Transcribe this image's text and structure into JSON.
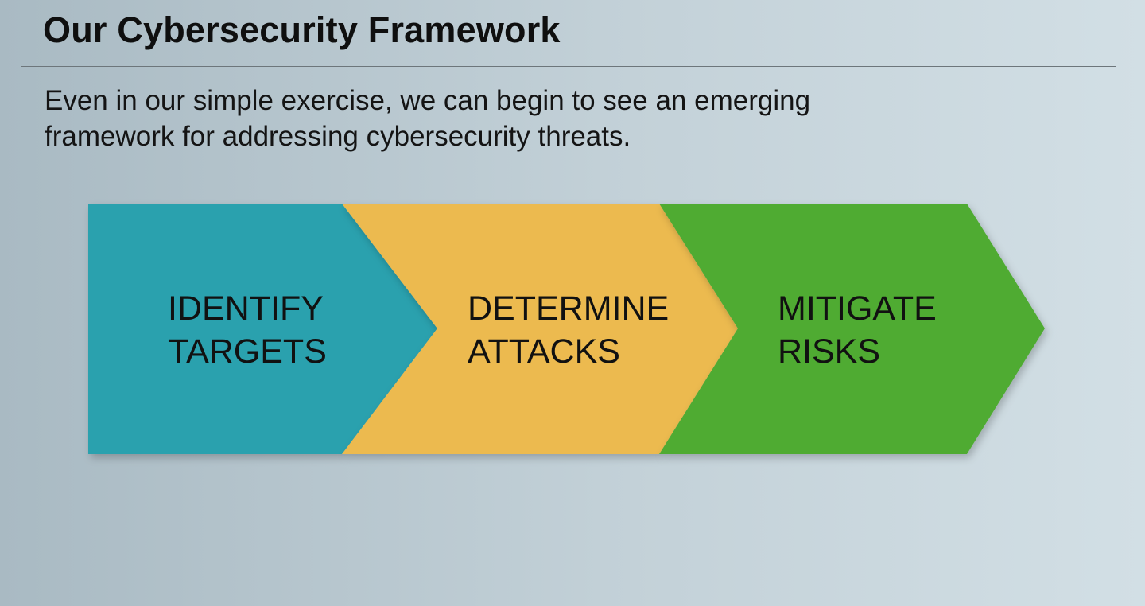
{
  "slide": {
    "title": "Our Cybersecurity Framework",
    "intro": "Even in our simple exercise, we can begin to see an emerging framework for addressing cybersecurity threats."
  },
  "steps": [
    {
      "line1": "IDENTIFY",
      "line2": "TARGETS",
      "color": "#2aa1ae"
    },
    {
      "line1": "DETERMINE",
      "line2": "ATTACKS",
      "color": "#ecba50"
    },
    {
      "line1": "MITIGATE",
      "line2": "RISKS",
      "color": "#4fab33"
    }
  ]
}
